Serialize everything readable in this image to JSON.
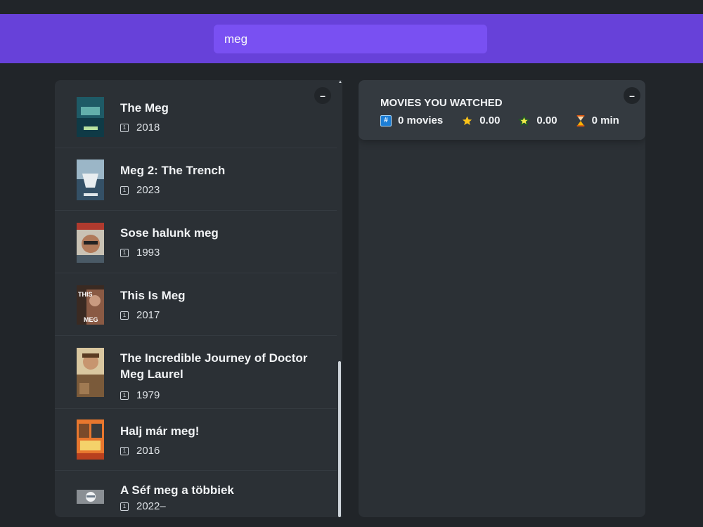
{
  "search": {
    "value": "meg"
  },
  "left_toggle": "–",
  "right_toggle": "–",
  "movies": [
    {
      "title": "The Meg",
      "year": "2018"
    },
    {
      "title": "Meg 2: The Trench",
      "year": "2023"
    },
    {
      "title": "Sose halunk meg",
      "year": "1993"
    },
    {
      "title": "This Is Meg",
      "year": "2017"
    },
    {
      "title": "The Incredible Journey of Doctor Meg Laurel",
      "year": "1979"
    },
    {
      "title": "Halj már meg!",
      "year": "2016"
    },
    {
      "title": "A Séf meg a többiek",
      "year": "2022–"
    }
  ],
  "icons": {
    "year": "calendar-icon",
    "movies": "hash-icon",
    "imdb": "star-icon",
    "user": "star-icon",
    "runtime": "hourglass-icon"
  },
  "summary": {
    "title": "Movies you watched",
    "movies": "0 movies",
    "imdb_rating": "0.00",
    "user_rating": "0.00",
    "runtime": "0 min"
  },
  "colors": {
    "navbar": "#6741d9",
    "search": "#7950f2",
    "background": "#212529",
    "box": "#2b3035",
    "summary": "#343a40"
  }
}
